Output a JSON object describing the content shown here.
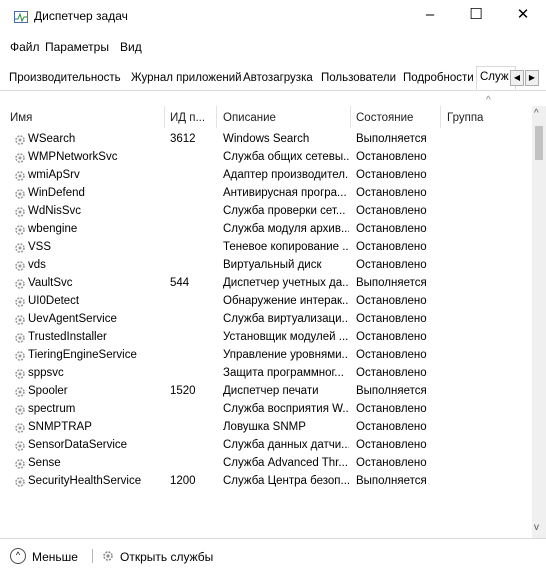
{
  "window": {
    "title": "Диспетчер задач",
    "minimize": "–",
    "maximize": "☐",
    "close": "✕"
  },
  "menu": [
    "Файл",
    "Параметры",
    "Вид"
  ],
  "tabs": [
    "Производительность",
    "Журнал приложений",
    "Автозагрузка",
    "Пользователи",
    "Подробности",
    "Служ"
  ],
  "active_tab": "Службы",
  "columns": [
    "Имя",
    "ИД п...",
    "Описание",
    "Состояние",
    "Группа"
  ],
  "services": [
    {
      "name": "WSearch",
      "pid": "3612",
      "desc": "Windows Search",
      "status": "Выполняется"
    },
    {
      "name": "WMPNetworkSvc",
      "pid": "",
      "desc": "Служба общих сетевы...",
      "status": "Остановлено"
    },
    {
      "name": "wmiApSrv",
      "pid": "",
      "desc": "Адаптер производител...",
      "status": "Остановлено"
    },
    {
      "name": "WinDefend",
      "pid": "",
      "desc": "Антивирусная програ...",
      "status": "Остановлено"
    },
    {
      "name": "WdNisSvc",
      "pid": "",
      "desc": "Служба проверки сет...",
      "status": "Остановлено"
    },
    {
      "name": "wbengine",
      "pid": "",
      "desc": "Служба модуля архив...",
      "status": "Остановлено"
    },
    {
      "name": "VSS",
      "pid": "",
      "desc": "Теневое копирование ...",
      "status": "Остановлено"
    },
    {
      "name": "vds",
      "pid": "",
      "desc": "Виртуальный диск",
      "status": "Остановлено"
    },
    {
      "name": "VaultSvc",
      "pid": "544",
      "desc": "Диспетчер учетных да...",
      "status": "Выполняется"
    },
    {
      "name": "UI0Detect",
      "pid": "",
      "desc": "Обнаружение интерак...",
      "status": "Остановлено"
    },
    {
      "name": "UevAgentService",
      "pid": "",
      "desc": "Служба виртуализаци...",
      "status": "Остановлено"
    },
    {
      "name": "TrustedInstaller",
      "pid": "",
      "desc": "Установщик модулей ...",
      "status": "Остановлено"
    },
    {
      "name": "TieringEngineService",
      "pid": "",
      "desc": "Управление уровнями...",
      "status": "Остановлено"
    },
    {
      "name": "sppsvc",
      "pid": "",
      "desc": "Защита программног...",
      "status": "Остановлено"
    },
    {
      "name": "Spooler",
      "pid": "1520",
      "desc": "Диспетчер печати",
      "status": "Выполняется"
    },
    {
      "name": "spectrum",
      "pid": "",
      "desc": "Служба восприятия W...",
      "status": "Остановлено"
    },
    {
      "name": "SNMPTRAP",
      "pid": "",
      "desc": "Ловушка SNMP",
      "status": "Остановлено"
    },
    {
      "name": "SensorDataService",
      "pid": "",
      "desc": "Служба данных датчи...",
      "status": "Остановлено"
    },
    {
      "name": "Sense",
      "pid": "",
      "desc": "Служба Advanced Thr...",
      "status": "Остановлено"
    },
    {
      "name": "SecurityHealthService",
      "pid": "1200",
      "desc": "Служба Центра безоп...",
      "status": "Выполняется"
    }
  ],
  "footer": {
    "less_label": "Меньше",
    "open_services_label": "Открыть службы"
  },
  "icons": {
    "app": "task-manager-icon",
    "service": "gear-icon",
    "less": "chevron-up-circle-icon"
  }
}
